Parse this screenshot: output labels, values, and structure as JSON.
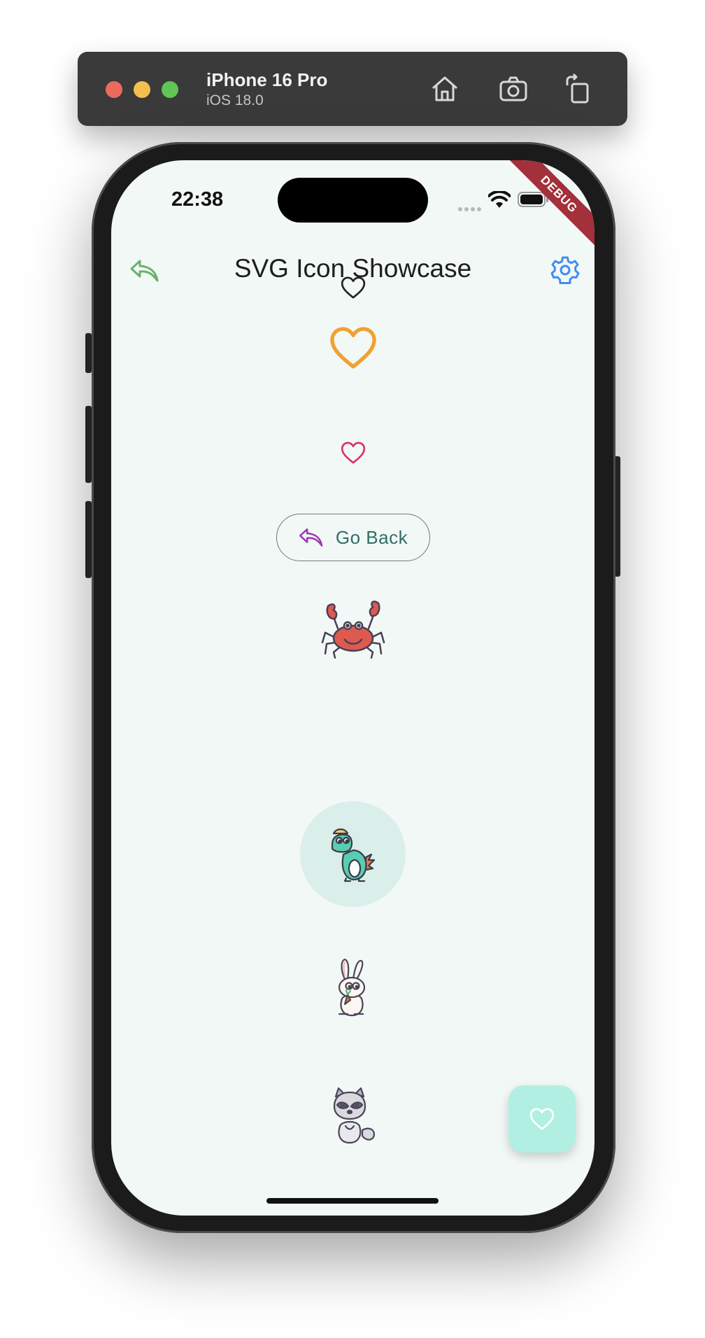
{
  "simulator": {
    "device_name": "iPhone 16 Pro",
    "os_version": "iOS 18.0",
    "icons": [
      "home-icon",
      "screenshot-icon",
      "rotate-icon"
    ]
  },
  "status_bar": {
    "time": "22:38",
    "debug_label": "DEBUG"
  },
  "app_bar": {
    "title": "SVG Icon Showcase",
    "back_icon_color": "#6ab06a",
    "settings_icon_color": "#3d8ef0"
  },
  "content": {
    "hearts": [
      {
        "icon": "heart-outline-icon",
        "color": "#222222"
      },
      {
        "icon": "heart-outline-icon",
        "color": "#f0a133"
      },
      {
        "icon": "heart-outline-icon",
        "color": "#d6336c"
      }
    ],
    "go_back_button": {
      "label": "Go Back",
      "icon": "reply-arrow-icon",
      "icon_color": "#9c36b5",
      "text_color": "#2f6e66"
    },
    "illustrations": [
      "crab-icon",
      "dinosaur-icon",
      "rabbit-icon",
      "raccoon-icon"
    ]
  },
  "fab": {
    "icon": "heart-outline-icon",
    "background": "#b2efe3"
  }
}
